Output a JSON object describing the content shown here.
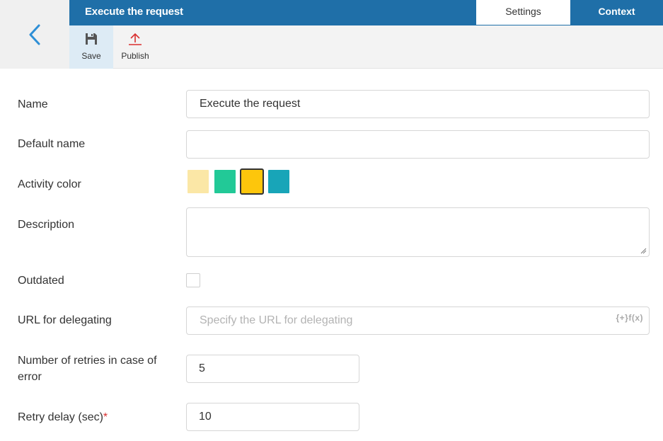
{
  "header": {
    "title": "Execute the request",
    "tabs": [
      {
        "label": "Settings",
        "active": true
      },
      {
        "label": "Context",
        "active": false
      }
    ]
  },
  "toolbar": {
    "save_label": "Save",
    "publish_label": "Publish"
  },
  "form": {
    "name": {
      "label": "Name",
      "value": "Execute the request"
    },
    "default_name": {
      "label": "Default name",
      "value": ""
    },
    "activity_color": {
      "label": "Activity color",
      "colors": [
        "#fbe7a6",
        "#22c997",
        "#fdc60c",
        "#18a5b8"
      ],
      "selected_index": 2
    },
    "description": {
      "label": "Description",
      "value": ""
    },
    "outdated": {
      "label": "Outdated",
      "checked": false
    },
    "url_delegating": {
      "label": "URL for delegating",
      "placeholder": "Specify the URL for delegating",
      "fx_label": "{+}f(x)"
    },
    "retries": {
      "label": "Number of retries in case of error",
      "value": "5"
    },
    "retry_delay": {
      "label": "Retry delay (sec)",
      "required_mark": "*",
      "value": "10"
    }
  },
  "icons": {
    "back": "chevron-left-icon",
    "save": "floppy-disk-icon",
    "publish": "upload-arrow-icon"
  },
  "colors": {
    "header_bg": "#1f6fa8",
    "accent_blue": "#2e8fd6",
    "publish_red": "#d93030"
  }
}
